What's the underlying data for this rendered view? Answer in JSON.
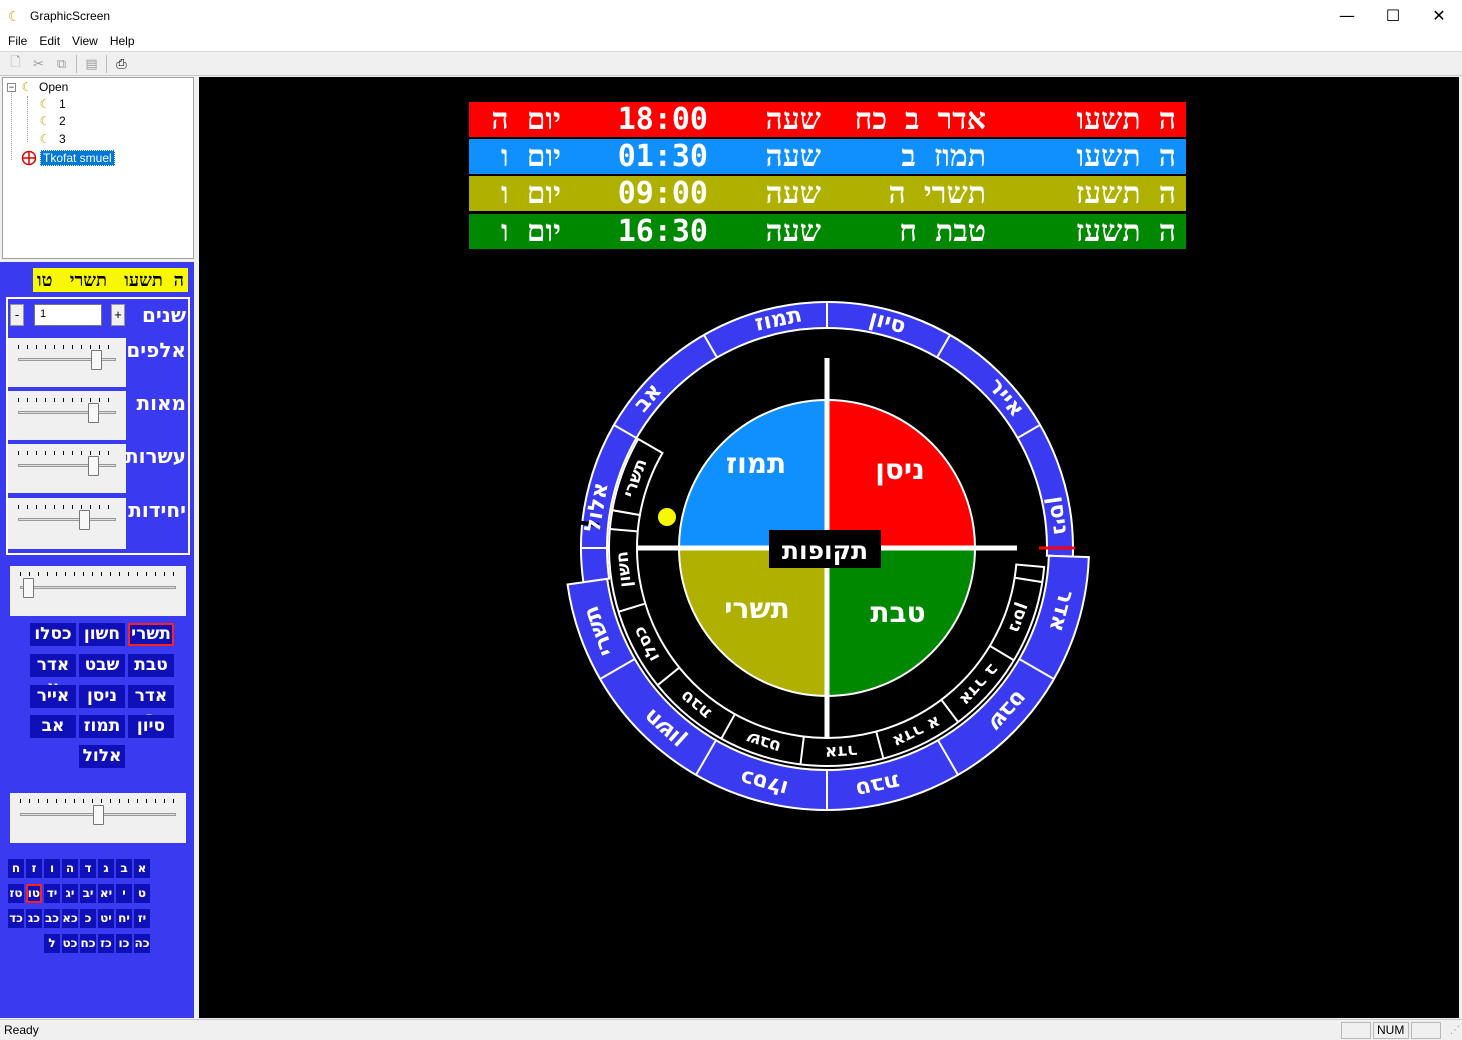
{
  "window": {
    "title": "GraphicScreen",
    "minimize": "—",
    "maximize": "☐",
    "close": "✕"
  },
  "menu": [
    "File",
    "Edit",
    "View",
    "Help"
  ],
  "tree": {
    "root": "Open",
    "children": [
      "1",
      "2",
      "3"
    ],
    "selected": "Tkofat smuel"
  },
  "panel": {
    "header": {
      "year": "ה תשעו",
      "month": "תשרי",
      "day": "טו"
    },
    "spinner": {
      "label": "שנים",
      "value": "1",
      "minus": "-",
      "plus": "+"
    },
    "sliders": [
      {
        "label": "אלפים",
        "level": 0.84
      },
      {
        "label": "מאות",
        "level": 0.8
      },
      {
        "label": "עשרות",
        "level": 0.8
      },
      {
        "label": "יחידות",
        "level": 0.7
      }
    ],
    "month_slider_level": 0.02,
    "months": [
      {
        "label": "תשרי",
        "selected": true
      },
      {
        "label": "חשון"
      },
      {
        "label": "כסלו"
      },
      {
        "label": "טבת"
      },
      {
        "label": "שבט"
      },
      {
        "label": "אדר א"
      },
      {
        "label": "אדר ב"
      },
      {
        "label": "ניסן"
      },
      {
        "label": "אייר"
      },
      {
        "label": "סיון"
      },
      {
        "label": "תמוז"
      },
      {
        "label": "אב"
      },
      {
        "label": "אלול"
      }
    ],
    "day_slider_level": 0.5,
    "days": [
      "א",
      "ב",
      "ג",
      "ד",
      "ה",
      "ו",
      "ז",
      "ח",
      "ט",
      "י",
      "יא",
      "יב",
      "יג",
      "יד",
      "טו",
      "טז",
      "יז",
      "יח",
      "יט",
      "כ",
      "כא",
      "כב",
      "כג",
      "כד",
      "כה",
      "כו",
      "כז",
      "כח",
      "כט",
      "ל"
    ],
    "selected_day": "טו"
  },
  "bars": [
    {
      "color": "#ff0000",
      "year": "ה תשעו",
      "date": "אדר ב כח",
      "hour_label": "שעה",
      "time": "18:00",
      "weekday": "יום ה"
    },
    {
      "color": "#1090ff",
      "year": "ה תשעו",
      "date": "תמוז ב",
      "hour_label": "שעה",
      "time": "01:30",
      "weekday": "יום ו"
    },
    {
      "color": "#b0b000",
      "year": "ה תשעז",
      "date": "תשרי ה",
      "hour_label": "שעה",
      "time": "09:00",
      "weekday": "יום ו"
    },
    {
      "color": "#008800",
      "year": "ה תשעז",
      "date": "טבת ח",
      "hour_label": "שעה",
      "time": "16:30",
      "weekday": "יום ו"
    }
  ],
  "dial": {
    "center_label": "תקופות",
    "quadrants": [
      {
        "label": "ניסן",
        "color": "#ff0000"
      },
      {
        "label": "תמוז",
        "color": "#1090ff"
      },
      {
        "label": "תשרי",
        "color": "#b0b000"
      },
      {
        "label": "טבת",
        "color": "#008800"
      }
    ],
    "outer_months": [
      "ניסן",
      "אייר",
      "סיון",
      "תמוז",
      "אב",
      "אלול",
      "תשרי",
      "חשון",
      "כסלו",
      "טבת",
      "שבט",
      "אדר"
    ],
    "inner_signs": [
      "תשרי",
      "חשון",
      "כסלו",
      "טבת",
      "שבט",
      "אדר",
      "אדר א",
      "אדר ב",
      "ניסן"
    ]
  },
  "status": {
    "ready": "Ready",
    "num": "NUM"
  }
}
